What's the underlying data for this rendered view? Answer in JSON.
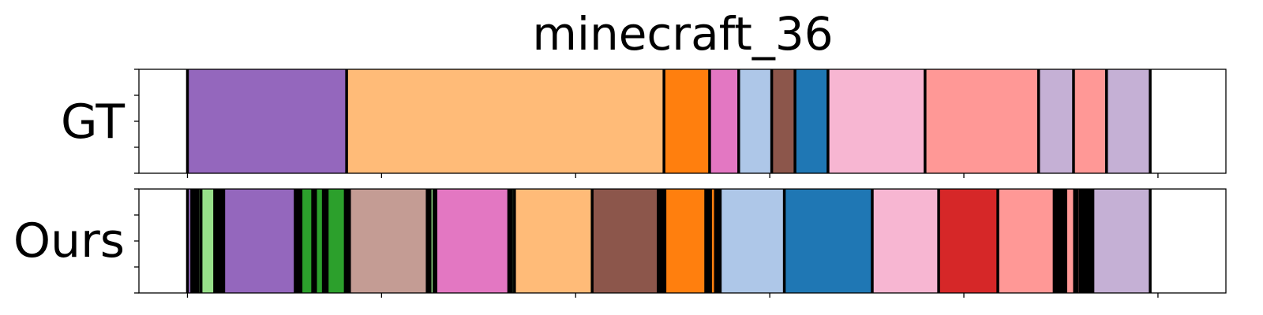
{
  "chart_data": {
    "type": "segmentation_timeline",
    "title": "minecraft_36",
    "xlim": [
      0,
      5600
    ],
    "x_ticks": [
      250,
      1250,
      2250,
      3250,
      4250,
      5250
    ],
    "rows": [
      {
        "label": "GT",
        "segments": [
          {
            "start": 250,
            "end": 1070,
            "color": "#9467bd"
          },
          {
            "start": 1070,
            "end": 2705,
            "color": "#ffbb78"
          },
          {
            "start": 2705,
            "end": 2940,
            "color": "#ff7f0e"
          },
          {
            "start": 2940,
            "end": 3090,
            "color": "#e377c2"
          },
          {
            "start": 3090,
            "end": 3260,
            "color": "#aec7e8"
          },
          {
            "start": 3260,
            "end": 3380,
            "color": "#8c564b"
          },
          {
            "start": 3380,
            "end": 3550,
            "color": "#1f77b4"
          },
          {
            "start": 3550,
            "end": 4050,
            "color": "#f7b6d2"
          },
          {
            "start": 4050,
            "end": 4635,
            "color": "#ff9896"
          },
          {
            "start": 4635,
            "end": 4815,
            "color": "#c5b0d5"
          },
          {
            "start": 4815,
            "end": 4985,
            "color": "#ff9896"
          },
          {
            "start": 4985,
            "end": 5210,
            "color": "#c5b0d5"
          }
        ]
      },
      {
        "label": "Ours",
        "segments": [
          {
            "start": 250,
            "end": 272,
            "color": "#9467bd"
          },
          {
            "start": 272,
            "end": 305,
            "color": "#000000"
          },
          {
            "start": 305,
            "end": 320,
            "color": "#98df8a"
          },
          {
            "start": 320,
            "end": 390,
            "color": "#98df8a"
          },
          {
            "start": 390,
            "end": 437,
            "color": "#000000"
          },
          {
            "start": 437,
            "end": 805,
            "color": "#9467bd"
          },
          {
            "start": 805,
            "end": 835,
            "color": "#000000"
          },
          {
            "start": 835,
            "end": 895,
            "color": "#2ca02c"
          },
          {
            "start": 895,
            "end": 910,
            "color": "#000000"
          },
          {
            "start": 910,
            "end": 950,
            "color": "#2ca02c"
          },
          {
            "start": 950,
            "end": 970,
            "color": "#000000"
          },
          {
            "start": 970,
            "end": 1063,
            "color": "#2ca02c"
          },
          {
            "start": 1063,
            "end": 1085,
            "color": "#000000"
          },
          {
            "start": 1085,
            "end": 1485,
            "color": "#c49c94"
          },
          {
            "start": 1485,
            "end": 1500,
            "color": "#000000"
          },
          {
            "start": 1500,
            "end": 1520,
            "color": "#98df8a"
          },
          {
            "start": 1520,
            "end": 1530,
            "color": "#000000"
          },
          {
            "start": 1530,
            "end": 1905,
            "color": "#e377c2"
          },
          {
            "start": 1905,
            "end": 1920,
            "color": "#000000"
          },
          {
            "start": 1920,
            "end": 1935,
            "color": "#98df8a"
          },
          {
            "start": 1935,
            "end": 2335,
            "color": "#ffbb78"
          },
          {
            "start": 2335,
            "end": 2675,
            "color": "#8c564b"
          },
          {
            "start": 2675,
            "end": 2710,
            "color": "#000000"
          },
          {
            "start": 2710,
            "end": 2920,
            "color": "#ff7f0e"
          },
          {
            "start": 2920,
            "end": 2945,
            "color": "#000000"
          },
          {
            "start": 2945,
            "end": 2970,
            "color": "#ff7f0e"
          },
          {
            "start": 2970,
            "end": 2995,
            "color": "#000000"
          },
          {
            "start": 2995,
            "end": 3325,
            "color": "#aec7e8"
          },
          {
            "start": 3325,
            "end": 3778,
            "color": "#1f77b4"
          },
          {
            "start": 3778,
            "end": 4120,
            "color": "#f7b6d2"
          },
          {
            "start": 4120,
            "end": 4425,
            "color": "#d62728"
          },
          {
            "start": 4425,
            "end": 4715,
            "color": "#ff9896"
          },
          {
            "start": 4715,
            "end": 4775,
            "color": "#000000"
          },
          {
            "start": 4775,
            "end": 4820,
            "color": "#ff9896"
          },
          {
            "start": 4820,
            "end": 4835,
            "color": "#000000"
          },
          {
            "start": 4835,
            "end": 4850,
            "color": "#ff9896"
          },
          {
            "start": 4850,
            "end": 4915,
            "color": "#000000"
          },
          {
            "start": 4915,
            "end": 5210,
            "color": "#c5b0d5"
          }
        ]
      }
    ],
    "boundary_color": "#000000",
    "grid": false,
    "legend": "none"
  }
}
